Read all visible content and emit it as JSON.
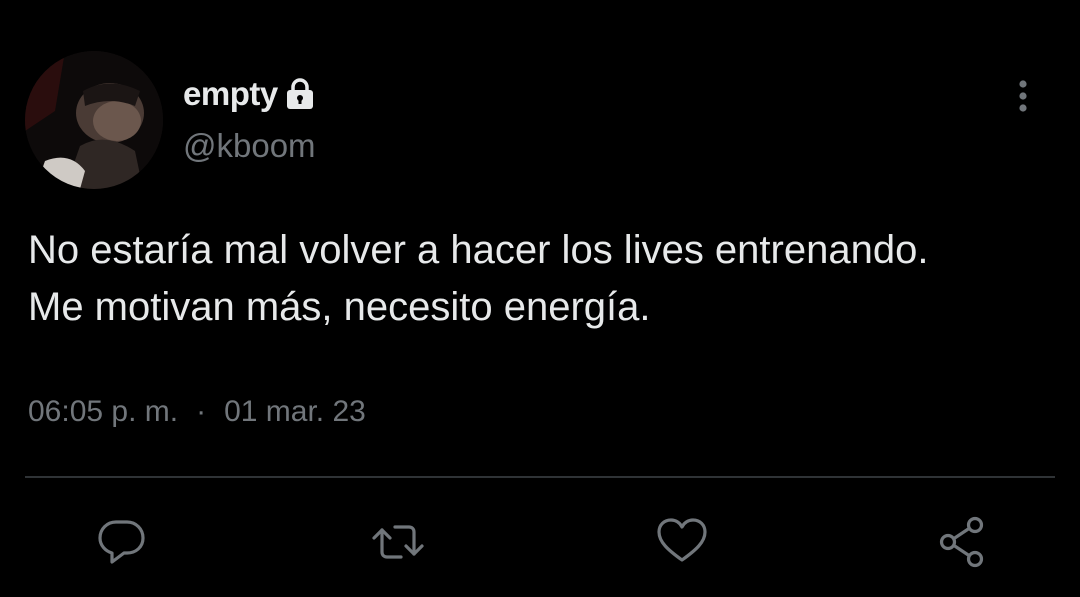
{
  "tweet": {
    "author": {
      "display_name": "empty",
      "handle": "@kboom",
      "protected_icon": "lock-icon",
      "avatar": "profile-photo"
    },
    "text": "No estaría mal volver a hacer los lives entrenando.\nMe motivan más, necesito energía.",
    "time": "06:05 p. m.",
    "separator": "·",
    "date": "01 mar. 23",
    "more_icon": "more-vertical-icon"
  },
  "actions": [
    {
      "name": "reply",
      "icon": "reply-icon"
    },
    {
      "name": "retweet",
      "icon": "retweet-icon"
    },
    {
      "name": "like",
      "icon": "heart-icon"
    },
    {
      "name": "share",
      "icon": "share-icon"
    }
  ],
  "colors": {
    "background": "#000000",
    "text_primary": "#e7e9ea",
    "text_secondary": "#71767b",
    "divider": "#2f3336"
  }
}
